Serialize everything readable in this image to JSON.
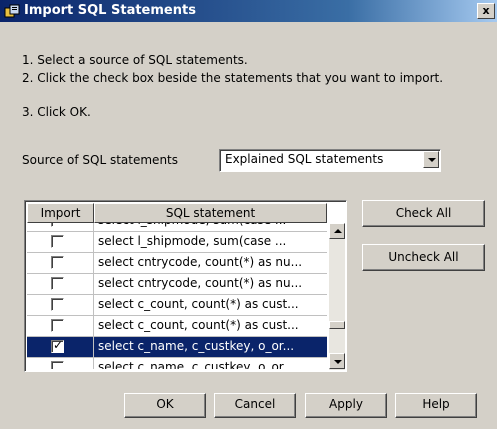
{
  "window": {
    "title": "Import SQL Statements",
    "close_label": "x"
  },
  "instructions": [
    "1. Select a source of SQL statements.",
    "2. Click the check box beside the statements that you want to import.",
    "3. Click OK."
  ],
  "source": {
    "label": "Source of SQL statements",
    "selected": "Explained SQL statements"
  },
  "table": {
    "columns": [
      "Import",
      "SQL statement"
    ],
    "rows": [
      {
        "checked": false,
        "sql": "select l_shipmode, sum(case ..."
      },
      {
        "checked": false,
        "sql": "select l_shipmode, sum(case ..."
      },
      {
        "checked": false,
        "sql": "select cntrycode, count(*) as nu..."
      },
      {
        "checked": false,
        "sql": "select cntrycode, count(*) as nu..."
      },
      {
        "checked": false,
        "sql": "select c_count, count(*) as cust..."
      },
      {
        "checked": false,
        "sql": "select c_count, count(*) as cust..."
      },
      {
        "checked": true,
        "sql": "select c_name, c_custkey, o_or..."
      },
      {
        "checked": false,
        "sql": "select c_name, c_custkey, o_or..."
      }
    ],
    "selected_row": 6
  },
  "side_buttons": {
    "check_all": "Check All",
    "uncheck_all": "Uncheck All"
  },
  "bottom_buttons": {
    "ok": "OK",
    "cancel": "Cancel",
    "apply": "Apply",
    "help": "Help"
  },
  "colors": {
    "title_bar": "#0a246a",
    "selection": "#0a246a",
    "face": "#d4d0c8"
  }
}
